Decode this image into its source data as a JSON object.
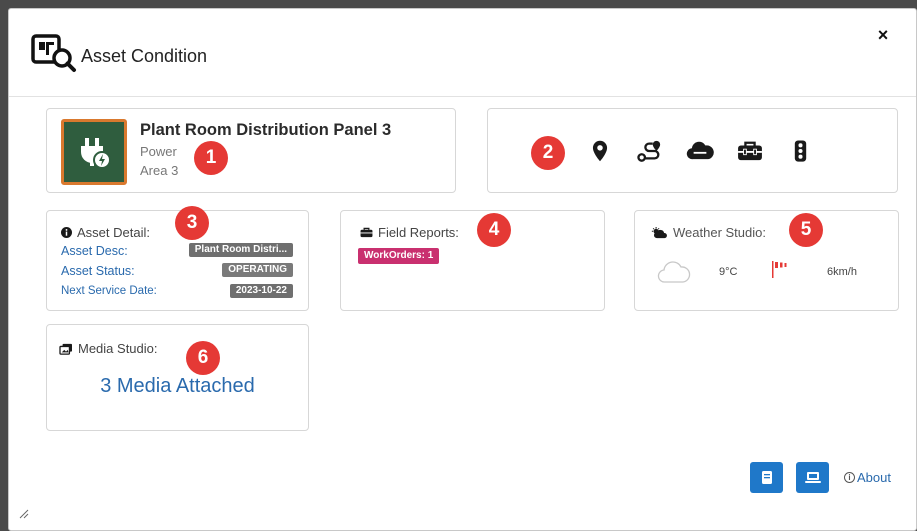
{
  "dialog": {
    "title": "Asset Condition",
    "close_label": "×"
  },
  "asset": {
    "name": "Plant Room Distribution Panel 3",
    "type": "Power",
    "area": "Area 3"
  },
  "tools": [
    "location-icon",
    "route-icon",
    "cloud-icon",
    "toolbox-icon",
    "traffic-light-icon"
  ],
  "annotations": [
    "1",
    "2",
    "3",
    "4",
    "5",
    "6"
  ],
  "asset_detail": {
    "title": "Asset Detail:",
    "desc_label": "Asset Desc:",
    "desc_value": "Plant Room Distri...",
    "status_label": "Asset Status:",
    "status_value": "OPERATING",
    "service_label": "Next Service Date:",
    "service_value": "2023-10-22"
  },
  "field_reports": {
    "title": "Field Reports:",
    "workorders_label": "WorkOrders: 1"
  },
  "weather": {
    "title": "Weather Studio:",
    "temperature": "9°C",
    "wind": "6km/h"
  },
  "media": {
    "title": "Media Studio:",
    "link_text": "3 Media Attached"
  },
  "footer": {
    "about_label": "About",
    "about_icon_glyph": "i"
  },
  "colors": {
    "accent_blue": "#1f78c9",
    "badge_red": "#e53935",
    "workorder_pink": "#c9306f",
    "asset_icon_bg": "#2f5d3e",
    "asset_icon_border": "#d9792e"
  }
}
